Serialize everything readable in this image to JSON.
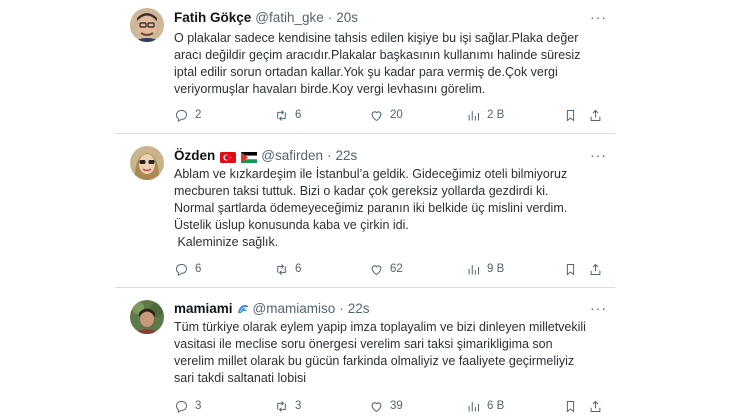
{
  "tweets": [
    {
      "name": "Fatih Gökçe",
      "handle": "@fatih_gke",
      "dot": "·",
      "time": "20s",
      "lines": [
        "O plakalar sadece kendisine tahsis edilen kişiye bu işi sağlar.Plaka değer",
        "aracı değildir geçim aracıdır.Plakalar başkasının kullanımı halinde süresiz",
        "iptal edilir sorun ortadan kallar.Yok şu kadar para vermiş de.Çok vergi",
        "veriyormuşlar havaları birde.Koy vergi levhasını görelim."
      ],
      "replies": "2",
      "retweets": "6",
      "likes": "20",
      "views": "2 B"
    },
    {
      "name": "Özden",
      "handle": "@safirden",
      "dot": "·",
      "time": "22s",
      "lines": [
        "Ablam ve kızkardeşim ile İstanbul’a geldik. Gideceğimiz oteli bilmiyoruz",
        "mecburen taksi tuttuk. Bizi o kadar çok gereksiz yollarda gezdirdi ki.",
        "Normal şartlarda ödemeyeceğimiz paranın iki belkide üç mislini verdim.",
        "Üstelik üslup konusunda kaba ve çirkin idi.",
        " Kaleminize sağlık."
      ],
      "replies": "6",
      "retweets": "6",
      "likes": "62",
      "views": "9 B"
    },
    {
      "name": "mamiami",
      "handle": "@mamiamiso",
      "dot": "·",
      "time": "22s",
      "lines": [
        "Tüm türkiye olarak eylem yapip imza toplayalim ve bizi dinleyen milletvekili",
        "vasitasi ile meclise soru önergesi verelim sari taksi şimarikligima son",
        "verelim millet olarak bu gücün farkinda olmaliyiz ve faaliyete geçirmeliyiz",
        "sari takdi saltanati lobisi"
      ],
      "replies": "3",
      "retweets": "3",
      "likes": "39",
      "views": "6 B"
    }
  ],
  "more_label": "···",
  "icons": [
    "reply-icon",
    "retweet-icon",
    "like-icon",
    "views-icon",
    "bookmark-icon",
    "share-icon"
  ],
  "colors": {
    "text": "#0f1419",
    "secondary": "#536471",
    "divider": "#d9dde1"
  }
}
